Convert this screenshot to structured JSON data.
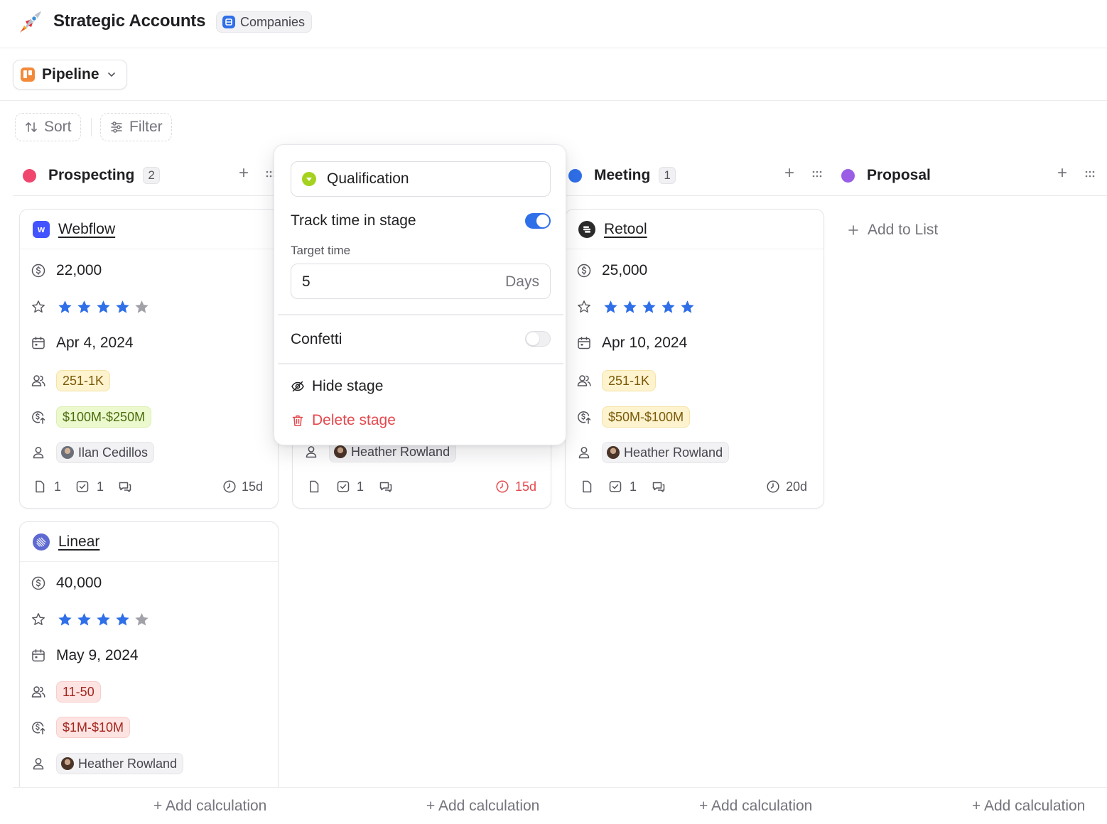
{
  "header": {
    "title": "Strategic Accounts",
    "object_badge": "Companies",
    "app_icon": "rocket-icon"
  },
  "view": {
    "name": "Pipeline",
    "icon": "kanban-icon"
  },
  "toolbar": {
    "sort_label": "Sort",
    "filter_label": "Filter"
  },
  "columns": [
    {
      "name": "Prospecting",
      "count": "2",
      "color": "#f0466e"
    },
    {
      "name": "Qualification",
      "count": "",
      "color": "#a4d21e"
    },
    {
      "name": "Meeting",
      "count": "1",
      "color": "#2f6fe8"
    },
    {
      "name": "Proposal",
      "count": "",
      "color": "#9b5de5"
    }
  ],
  "cards": [
    {
      "company": "Webflow",
      "logo_letter": "w",
      "logo_color": "#4353ff",
      "amount": "22,000",
      "rating": 4,
      "date": "Apr 4, 2024",
      "employees": "251-1K",
      "revenue": "$100M-$250M",
      "owner": "Ilan Cedillos",
      "files": "1",
      "tasks": "1",
      "comments": "",
      "time_in_stage": "15d"
    },
    {
      "company": "Linear",
      "logo_letter": "",
      "logo_color": "#5e6ad2",
      "amount": "40,000",
      "rating": 4,
      "date": "May 9, 2024",
      "employees": "11-50",
      "revenue": "$1M-$10M",
      "owner": "Heather Rowland"
    },
    {
      "company": "",
      "owner": "Heather Rowland",
      "files": "",
      "tasks": "1",
      "comments": "",
      "time_in_stage": "15d",
      "overdue_color": "#e5484d"
    },
    {
      "company": "Retool",
      "logo_letter": "",
      "logo_color": "#2b2b2b",
      "amount": "25,000",
      "rating": 5,
      "date": "Apr 10, 2024",
      "employees": "251-1K",
      "revenue": "$50M-$100M",
      "owner": "Heather Rowland",
      "files": "",
      "tasks": "1",
      "comments": "",
      "time_in_stage": "20d"
    }
  ],
  "add_to_list": "Add to List",
  "stage_popover": {
    "stage_name": "Qualification",
    "track_time_label": "Track time in stage",
    "track_time_enabled": true,
    "target_time_label": "Target time",
    "target_time_value": "5",
    "target_time_unit": "Days",
    "confetti_label": "Confetti",
    "confetti_enabled": false,
    "hide_stage_label": "Hide stage",
    "delete_stage_label": "Delete stage"
  },
  "add_calculation_label": "+ Add calculation",
  "colors": {
    "accent": "#2f6fe8",
    "star_filled": "#2f6fe8",
    "star_empty": "#a1a1a8",
    "danger": "#e5484d"
  }
}
